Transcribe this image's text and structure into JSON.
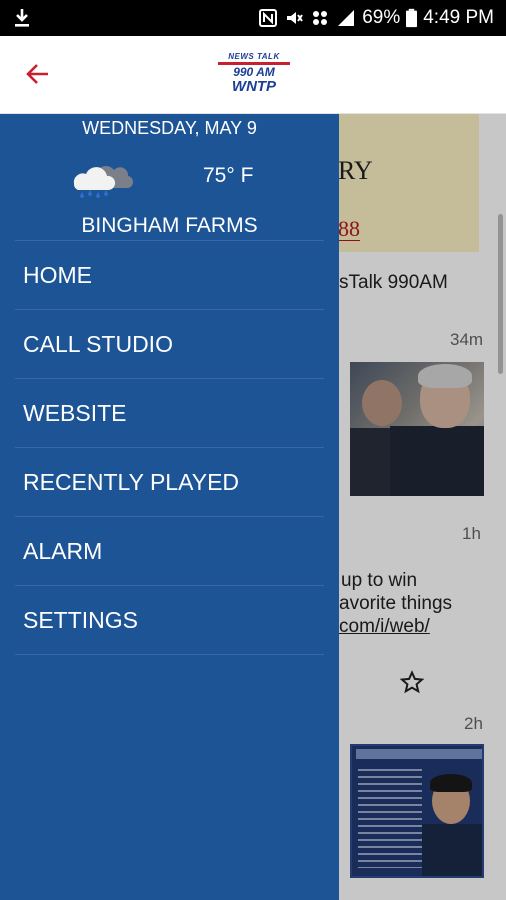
{
  "status_bar": {
    "battery_percent": "69%",
    "time": "4:49 PM"
  },
  "app_bar": {
    "back_icon": "back-arrow-icon",
    "logo": {
      "line1": "NEWS TALK",
      "line2": "990 AM",
      "line3": "WNTP"
    }
  },
  "drawer": {
    "date": "WEDNESDAY, MAY 9",
    "weather_icon": "rain-cloud-icon",
    "temperature": "75° F",
    "location": "BINGHAM FARMS",
    "menu_items": [
      {
        "label": "HOME"
      },
      {
        "label": "CALL STUDIO"
      },
      {
        "label": "WEBSITE"
      },
      {
        "label": "RECENTLY PLAYED"
      },
      {
        "label": "ALARM"
      },
      {
        "label": "SETTINGS"
      }
    ]
  },
  "background": {
    "banner_text_1": "RY",
    "banner_text_2": "88",
    "post_source": "sTalk 990AM",
    "post1_time": "34m",
    "post2_time": "1h",
    "post2_line1": "up to win",
    "post2_line2": "avorite things",
    "post2_line3": "com/i/web/",
    "post3_time": "2h"
  },
  "colors": {
    "drawer_bg": "#1c5496",
    "accent_red": "#c7202f",
    "brand_blue": "#1b3f95"
  }
}
